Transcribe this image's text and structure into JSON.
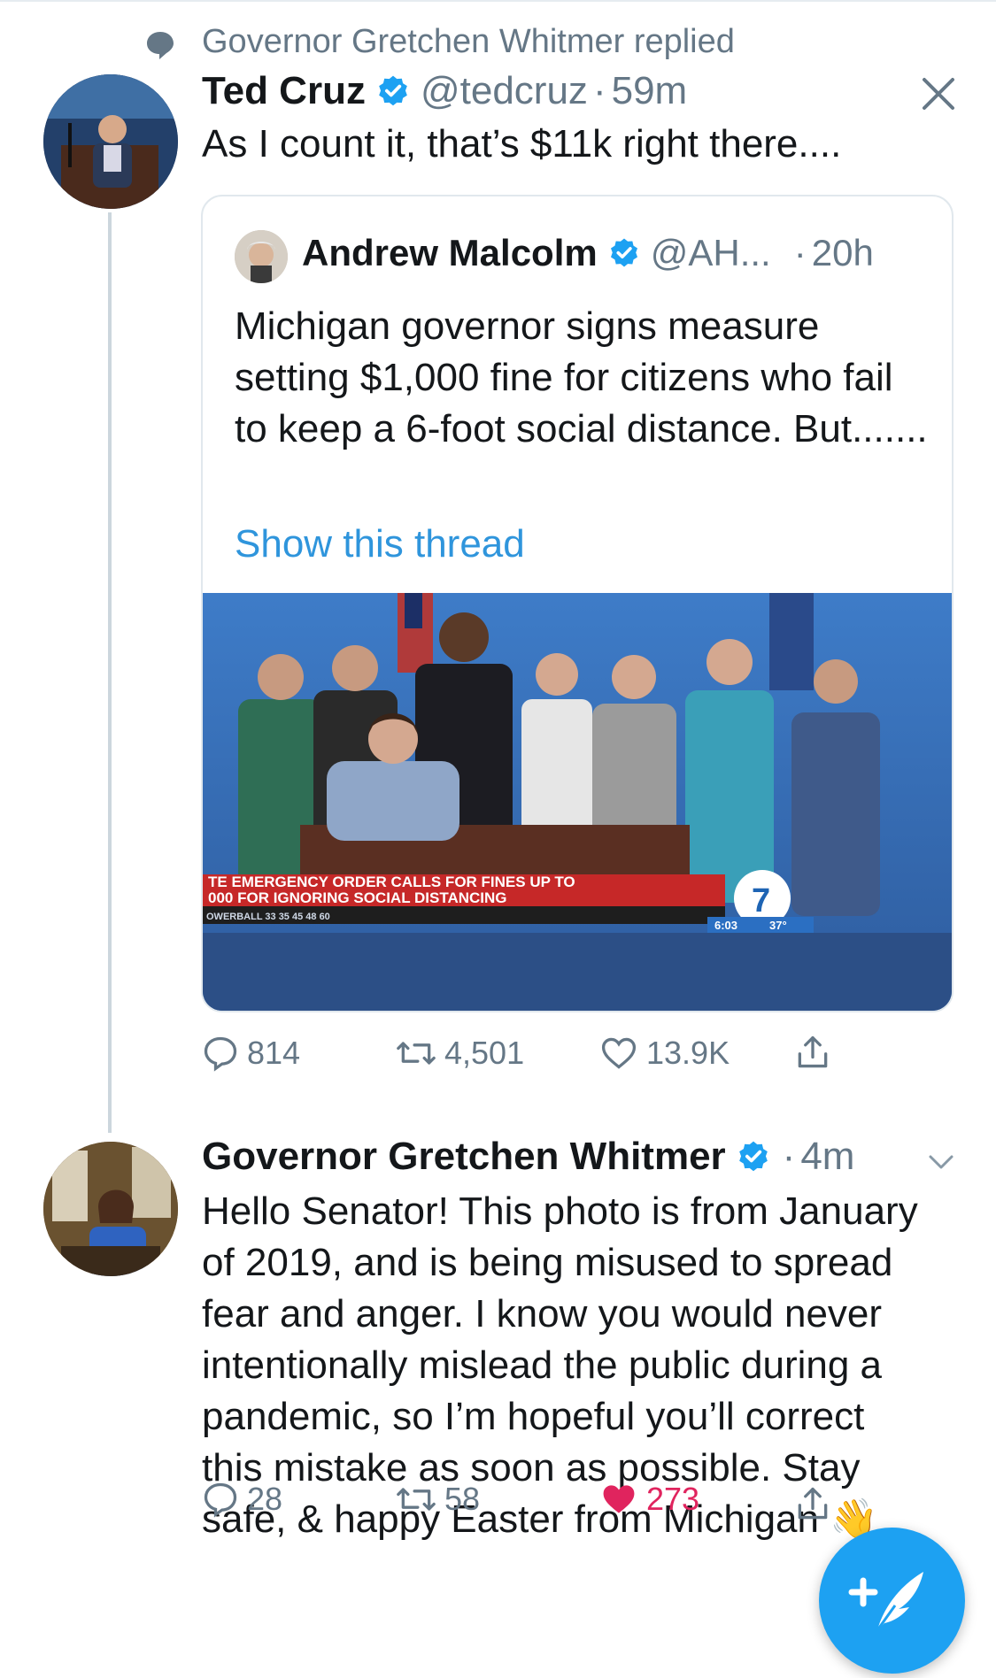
{
  "context": {
    "text": "Governor Gretchen Whitmer replied"
  },
  "main_tweet": {
    "name": "Ted Cruz",
    "handle": "@tedcruz",
    "sep": "·",
    "time": "59m",
    "text": "As I count it, that’s $11k right there...."
  },
  "quoted_tweet": {
    "name": "Andrew Malcolm",
    "handle": "@AH...",
    "sep": "·",
    "time": "20h",
    "text": "Michigan governor signs measure setting $1,000 fine for citizens who fail to keep a 6-foot social distance. But.......",
    "show_thread": "Show this thread",
    "image": {
      "caption_line1": "TE EMERGENCY ORDER CALLS FOR FINES UP TO",
      "caption_line2": "000 FOR IGNORING SOCIAL DISTANCING",
      "ticker": "OWERBALL  33  35  45  48  60",
      "clock": "6:03",
      "temp": "37°"
    }
  },
  "main_actions": {
    "replies": "814",
    "retweets": "4,501",
    "likes": "13.9K"
  },
  "reply_tweet": {
    "name": "Governor Gretchen Whitmer",
    "sep": "·",
    "time": "4m",
    "text": "Hello Senator! This photo is from January\nof 2019, and is being misused to spread\nfear and anger. I know you would never\nintentionally mislead the public during a\npandemic, so I’m hopeful you’ll correct\nthis mistake as soon as possible. Stay\nsafe, & happy Easter from Michigan 👋"
  },
  "reply_actions": {
    "replies": "28",
    "retweets": "58",
    "likes": "273"
  },
  "colors": {
    "accent": "#1da1f2",
    "link": "#2f95dc",
    "like_active": "#e0245e",
    "muted": "#657786"
  },
  "icons": [
    "speech-bubble-icon",
    "verified-badge-icon",
    "close-icon",
    "reply-icon",
    "retweet-icon",
    "like-icon",
    "share-icon",
    "chevron-down-icon",
    "compose-tweet-icon"
  ]
}
